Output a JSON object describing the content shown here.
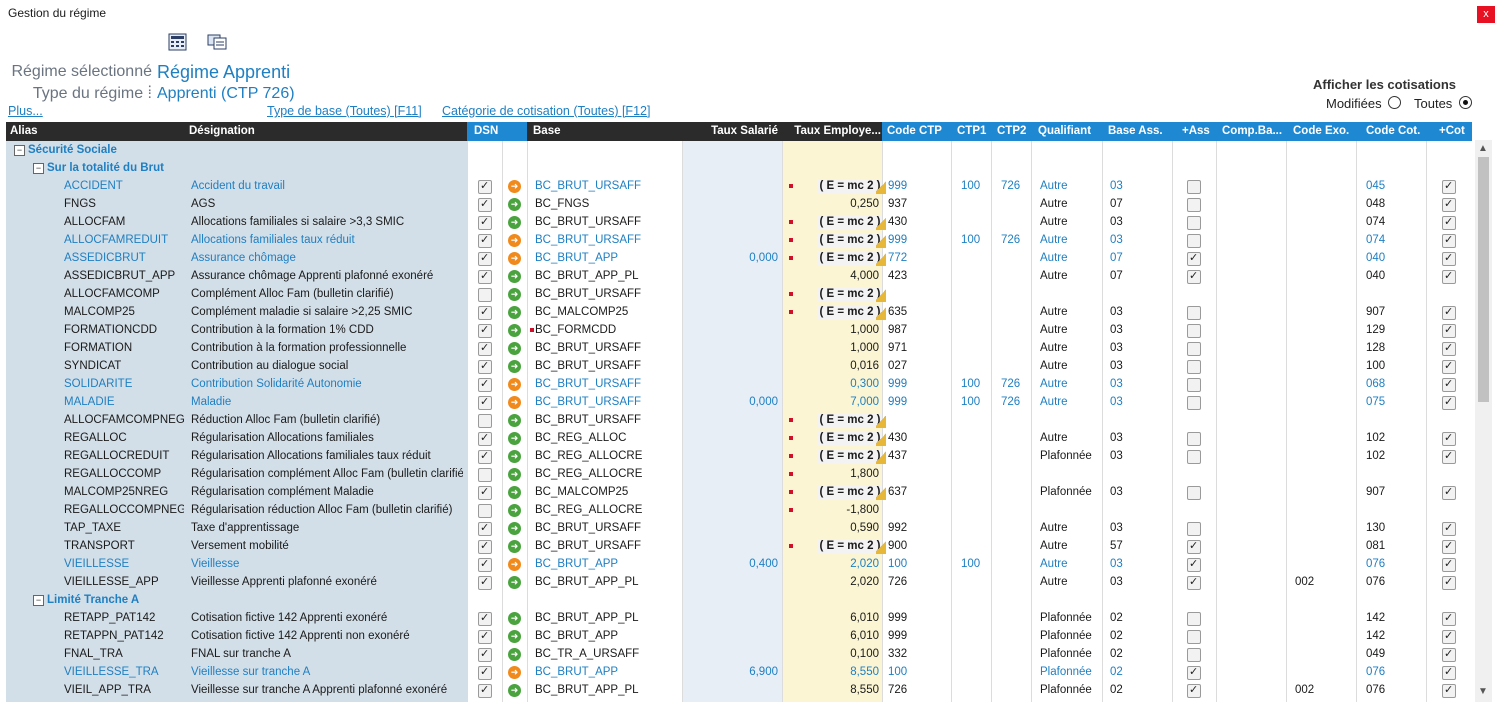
{
  "window": {
    "title": "Gestion du régime",
    "close_label": "x"
  },
  "toolbar": [
    {
      "icon": "calculator-icon"
    },
    {
      "icon": "monitor-icon"
    }
  ],
  "regime": {
    "selected_label": "Régime sélectionné :",
    "selected_value": "Régime Apprenti",
    "type_label": "Type du régime :",
    "type_value": "Apprenti (CTP 726)"
  },
  "links": {
    "plus": "Plus...",
    "type_base": "Type de base (Toutes) [F11]",
    "categorie": "Catégorie de cotisation (Toutes) [F12]"
  },
  "filter": {
    "title": "Afficher les cotisations",
    "modified": "Modifiées",
    "all": "Toutes",
    "selected": "all"
  },
  "columns": [
    "Alias",
    "Désignation",
    "DSN",
    "Base",
    "Taux Salarié",
    "Taux Employe...",
    "Code CTP",
    "CTP1",
    "CTP2",
    "Qualifiant",
    "Base Ass.",
    "+Ass",
    "Comp.Ba...",
    "Code Exo.",
    "Code Cot.",
    "+Cot"
  ],
  "formula_text": "( E = mc 2 )",
  "tree": {
    "root": "Sécurité Sociale",
    "group1": "Sur la totalité du Brut",
    "group2": "Limité Tranche A"
  },
  "rows1": [
    {
      "alias": "ACCIDENT",
      "des": "Accident du travail",
      "dsn": true,
      "arrow": "o",
      "base": "BC_BRUT_URSAFF",
      "ts": "",
      "te": "",
      "f": true,
      "ctp": "999",
      "c1": "100",
      "c2": "726",
      "q": "Autre",
      "ba": "03",
      "ass": false,
      "comp": "",
      "exo": "",
      "cot": "045",
      "plus": true,
      "blue": true
    },
    {
      "alias": "FNGS",
      "des": "AGS",
      "dsn": true,
      "arrow": "g",
      "base": "BC_FNGS",
      "ts": "",
      "te": "0,250",
      "f": false,
      "ctp": "937",
      "c1": "",
      "c2": "",
      "q": "Autre",
      "ba": "07",
      "ass": false,
      "comp": "",
      "exo": "",
      "cot": "048",
      "plus": true,
      "blue": false
    },
    {
      "alias": "ALLOCFAM",
      "des": "Allocations familiales si salaire >3,3 SMIC",
      "dsn": true,
      "arrow": "g",
      "base": "BC_BRUT_URSAFF",
      "ts": "",
      "te": "",
      "f": true,
      "ctp": "430",
      "c1": "",
      "c2": "",
      "q": "Autre",
      "ba": "03",
      "ass": false,
      "comp": "",
      "exo": "",
      "cot": "074",
      "plus": true,
      "blue": false
    },
    {
      "alias": "ALLOCFAMREDUIT",
      "des": "Allocations familiales taux réduit",
      "dsn": true,
      "arrow": "o",
      "base": "BC_BRUT_URSAFF",
      "ts": "",
      "te": "",
      "f": true,
      "ctp": "999",
      "c1": "100",
      "c2": "726",
      "q": "Autre",
      "ba": "03",
      "ass": false,
      "comp": "",
      "exo": "",
      "cot": "074",
      "plus": true,
      "blue": true
    },
    {
      "alias": "ASSEDICBRUT",
      "des": "Assurance chômage",
      "dsn": true,
      "arrow": "o",
      "base": "BC_BRUT_APP",
      "ts": "0,000",
      "te": "",
      "f": true,
      "ctp": "772",
      "c1": "",
      "c2": "",
      "q": "Autre",
      "ba": "07",
      "ass": true,
      "comp": "",
      "exo": "",
      "cot": "040",
      "plus": true,
      "blue": true
    },
    {
      "alias": "ASSEDICBRUT_APP",
      "des": "Assurance chômage Apprenti plafonné exonéré",
      "dsn": true,
      "arrow": "g",
      "base": "BC_BRUT_APP_PL",
      "ts": "",
      "te": "4,000",
      "f": false,
      "ctp": "423",
      "c1": "",
      "c2": "",
      "q": "Autre",
      "ba": "07",
      "ass": true,
      "comp": "",
      "exo": "",
      "cot": "040",
      "plus": true,
      "blue": false
    },
    {
      "alias": "ALLOCFAMCOMP",
      "des": "Complément Alloc Fam (bulletin clarifié)",
      "dsn": false,
      "arrow": "g",
      "base": "BC_BRUT_URSAFF",
      "ts": "",
      "te": "",
      "f": true,
      "ctp": "",
      "c1": "",
      "c2": "",
      "q": "",
      "ba": "",
      "ass": null,
      "comp": "",
      "exo": "",
      "cot": "",
      "plus": null,
      "blue": false
    },
    {
      "alias": "MALCOMP25",
      "des": "Complément maladie si salaire >2,25 SMIC",
      "dsn": true,
      "arrow": "g",
      "base": "BC_MALCOMP25",
      "ts": "",
      "te": "",
      "f": true,
      "ctp": "635",
      "c1": "",
      "c2": "",
      "q": "Autre",
      "ba": "03",
      "ass": false,
      "comp": "",
      "exo": "",
      "cot": "907",
      "plus": true,
      "blue": false
    },
    {
      "alias": "FORMATIONCDD",
      "des": "Contribution à la formation 1% CDD",
      "dsn": true,
      "arrow": "g",
      "base": "BC_FORMCDD",
      "ts": "",
      "te": "1,000",
      "f": false,
      "ctp": "987",
      "c1": "",
      "c2": "",
      "q": "Autre",
      "ba": "03",
      "ass": false,
      "comp": "",
      "exo": "",
      "cot": "129",
      "plus": true,
      "blue": false
    },
    {
      "alias": "FORMATION",
      "des": "Contribution à la formation professionnelle",
      "dsn": true,
      "arrow": "g",
      "base": "BC_BRUT_URSAFF",
      "ts": "",
      "te": "1,000",
      "f": false,
      "ctp": "971",
      "c1": "",
      "c2": "",
      "q": "Autre",
      "ba": "03",
      "ass": false,
      "comp": "",
      "exo": "",
      "cot": "128",
      "plus": true,
      "blue": false
    },
    {
      "alias": "SYNDICAT",
      "des": "Contribution au dialogue social",
      "dsn": true,
      "arrow": "g",
      "base": "BC_BRUT_URSAFF",
      "ts": "",
      "te": "0,016",
      "f": false,
      "ctp": "027",
      "c1": "",
      "c2": "",
      "q": "Autre",
      "ba": "03",
      "ass": false,
      "comp": "",
      "exo": "",
      "cot": "100",
      "plus": true,
      "blue": false
    },
    {
      "alias": "SOLIDARITE",
      "des": "Contribution Solidarité Autonomie",
      "dsn": true,
      "arrow": "o",
      "base": "BC_BRUT_URSAFF",
      "ts": "",
      "te": "0,300",
      "f": false,
      "ctp": "999",
      "c1": "100",
      "c2": "726",
      "q": "Autre",
      "ba": "03",
      "ass": false,
      "comp": "",
      "exo": "",
      "cot": "068",
      "plus": true,
      "blue": true
    },
    {
      "alias": "MALADIE",
      "des": "Maladie",
      "dsn": true,
      "arrow": "o",
      "base": "BC_BRUT_URSAFF",
      "ts": "0,000",
      "te": "7,000",
      "f": false,
      "ctp": "999",
      "c1": "100",
      "c2": "726",
      "q": "Autre",
      "ba": "03",
      "ass": false,
      "comp": "",
      "exo": "",
      "cot": "075",
      "plus": true,
      "blue": true
    },
    {
      "alias": "ALLOCFAMCOMPNEG",
      "des": "Réduction Alloc Fam (bulletin clarifié)",
      "dsn": false,
      "arrow": "g",
      "base": "BC_BRUT_URSAFF",
      "ts": "",
      "te": "",
      "f": true,
      "ctp": "",
      "c1": "",
      "c2": "",
      "q": "",
      "ba": "",
      "ass": null,
      "comp": "",
      "exo": "",
      "cot": "",
      "plus": null,
      "blue": false
    },
    {
      "alias": "REGALLOC",
      "des": "Régularisation Allocations familiales",
      "dsn": true,
      "arrow": "g",
      "base": "BC_REG_ALLOC",
      "ts": "",
      "te": "",
      "f": true,
      "ctp": "430",
      "c1": "",
      "c2": "",
      "q": "Autre",
      "ba": "03",
      "ass": false,
      "comp": "",
      "exo": "",
      "cot": "102",
      "plus": true,
      "blue": false
    },
    {
      "alias": "REGALLOCREDUIT",
      "des": "Régularisation Allocations familiales taux réduit",
      "dsn": true,
      "arrow": "g",
      "base": "BC_REG_ALLOCRE",
      "ts": "",
      "te": "",
      "f": true,
      "ctp": "437",
      "c1": "",
      "c2": "",
      "q": "Plafonnée",
      "ba": "03",
      "ass": false,
      "comp": "",
      "exo": "",
      "cot": "102",
      "plus": true,
      "blue": false
    },
    {
      "alias": "REGALLOCCOMP",
      "des": "Régularisation complément Alloc Fam (bulletin clarifié)",
      "dsn": false,
      "arrow": "g",
      "base": "BC_REG_ALLOCRE",
      "ts": "",
      "te": "1,800",
      "f": false,
      "ctp": "",
      "c1": "",
      "c2": "",
      "q": "",
      "ba": "",
      "ass": null,
      "comp": "",
      "exo": "",
      "cot": "",
      "plus": null,
      "blue": false,
      "dot": true
    },
    {
      "alias": "MALCOMP25NREG",
      "des": "Régularisation complément Maladie",
      "dsn": true,
      "arrow": "g",
      "base": "BC_MALCOMP25",
      "ts": "",
      "te": "",
      "f": true,
      "ctp": "637",
      "c1": "",
      "c2": "",
      "q": "Plafonnée",
      "ba": "03",
      "ass": false,
      "comp": "",
      "exo": "",
      "cot": "907",
      "plus": true,
      "blue": false
    },
    {
      "alias": "REGALLOCCOMPNEG",
      "des": "Régularisation réduction Alloc Fam (bulletin clarifié)",
      "dsn": false,
      "arrow": "g",
      "base": "BC_REG_ALLOCRE",
      "ts": "",
      "te": "-1,800",
      "f": false,
      "ctp": "",
      "c1": "",
      "c2": "",
      "q": "",
      "ba": "",
      "ass": null,
      "comp": "",
      "exo": "",
      "cot": "",
      "plus": null,
      "blue": false,
      "dot": true
    },
    {
      "alias": "TAP_TAXE",
      "des": "Taxe d'apprentissage",
      "dsn": true,
      "arrow": "g",
      "base": "BC_BRUT_URSAFF",
      "ts": "",
      "te": "0,590",
      "f": false,
      "ctp": "992",
      "c1": "",
      "c2": "",
      "q": "Autre",
      "ba": "03",
      "ass": false,
      "comp": "",
      "exo": "",
      "cot": "130",
      "plus": true,
      "blue": false
    },
    {
      "alias": "TRANSPORT",
      "des": "Versement mobilité",
      "dsn": true,
      "arrow": "g",
      "base": "BC_BRUT_URSAFF",
      "ts": "",
      "te": "",
      "f": true,
      "ctp": "900",
      "c1": "",
      "c2": "",
      "q": "Autre",
      "ba": "57",
      "ass": true,
      "comp": "",
      "exo": "",
      "cot": "081",
      "plus": true,
      "blue": false
    },
    {
      "alias": "VIEILLESSE",
      "des": "Vieillesse",
      "dsn": true,
      "arrow": "o",
      "base": "BC_BRUT_APP",
      "ts": "0,400",
      "te": "2,020",
      "f": false,
      "ctp": "100",
      "c1": "100",
      "c2": "",
      "q": "Autre",
      "ba": "03",
      "ass": true,
      "comp": "",
      "exo": "",
      "cot": "076",
      "plus": true,
      "blue": true
    },
    {
      "alias": "VIEILLESSE_APP",
      "des": "Vieillesse Apprenti plafonné exonéré",
      "dsn": true,
      "arrow": "g",
      "base": "BC_BRUT_APP_PL",
      "ts": "",
      "te": "2,020",
      "f": false,
      "ctp": "726",
      "c1": "",
      "c2": "",
      "q": "Autre",
      "ba": "03",
      "ass": true,
      "comp": "",
      "exo": "002",
      "cot": "076",
      "plus": true,
      "blue": false
    }
  ],
  "rows2": [
    {
      "alias": "RETAPP_PAT142",
      "des": "Cotisation fictive 142 Apprenti exonéré",
      "dsn": true,
      "arrow": "g",
      "base": "BC_BRUT_APP_PL",
      "ts": "",
      "te": "6,010",
      "f": false,
      "ctp": "999",
      "c1": "",
      "c2": "",
      "q": "Plafonnée",
      "ba": "02",
      "ass": false,
      "comp": "",
      "exo": "",
      "cot": "142",
      "plus": true,
      "blue": false
    },
    {
      "alias": "RETAPPN_PAT142",
      "des": "Cotisation fictive 142 Apprenti non exonéré",
      "dsn": true,
      "arrow": "g",
      "base": "BC_BRUT_APP",
      "ts": "",
      "te": "6,010",
      "f": false,
      "ctp": "999",
      "c1": "",
      "c2": "",
      "q": "Plafonnée",
      "ba": "02",
      "ass": false,
      "comp": "",
      "exo": "",
      "cot": "142",
      "plus": true,
      "blue": false
    },
    {
      "alias": "FNAL_TRA",
      "des": "FNAL sur tranche A",
      "dsn": true,
      "arrow": "g",
      "base": "BC_TR_A_URSAFF",
      "ts": "",
      "te": "0,100",
      "f": false,
      "ctp": "332",
      "c1": "",
      "c2": "",
      "q": "Plafonnée",
      "ba": "02",
      "ass": false,
      "comp": "",
      "exo": "",
      "cot": "049",
      "plus": true,
      "blue": false
    },
    {
      "alias": "VIEILLESSE_TRA",
      "des": "Vieillesse sur tranche A",
      "dsn": true,
      "arrow": "o",
      "base": "BC_BRUT_APP",
      "ts": "6,900",
      "te": "8,550",
      "f": false,
      "ctp": "100",
      "c1": "",
      "c2": "",
      "q": "Plafonnée",
      "ba": "02",
      "ass": true,
      "comp": "",
      "exo": "",
      "cot": "076",
      "plus": true,
      "blue": true
    },
    {
      "alias": "VIEIL_APP_TRA",
      "des": "Vieillesse sur tranche A Apprenti plafonné exonéré",
      "dsn": true,
      "arrow": "g",
      "base": "BC_BRUT_APP_PL",
      "ts": "",
      "te": "8,550",
      "f": false,
      "ctp": "726",
      "c1": "",
      "c2": "",
      "q": "Plafonnée",
      "ba": "02",
      "ass": true,
      "comp": "",
      "exo": "002",
      "cot": "076",
      "plus": true,
      "blue": false
    }
  ]
}
